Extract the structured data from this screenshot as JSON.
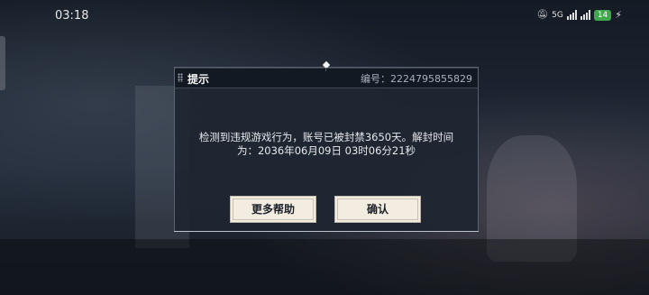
{
  "status_bar": {
    "time": "03:18",
    "network_label": "5G",
    "battery_level": "14"
  },
  "dialog": {
    "title": "提示",
    "id_text": "编号：2224795855829",
    "message": "检测到违规游戏行为，账号已被封禁3650天。解封时间为：2036年06月09日 03时06分21秒",
    "buttons": {
      "help": "更多帮助",
      "confirm": "确认"
    }
  },
  "colors": {
    "battery": "#3ea84a",
    "button_bg": "#f3ede1",
    "dialog_bg": "#1e2631"
  }
}
